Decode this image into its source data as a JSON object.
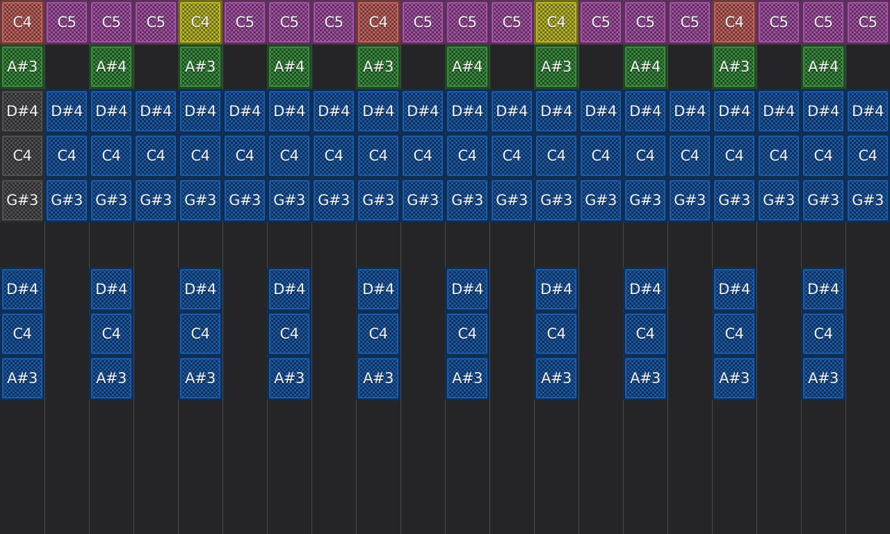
{
  "colors": {
    "background": "#252527",
    "grid_line": "#4a4a4d",
    "pink": [
      "#5c2f5c",
      "#a352a3"
    ],
    "red": [
      "#6b3a3a",
      "#c0605a"
    ],
    "yellow": [
      "#6d6a1a",
      "#b5b52a"
    ],
    "green": [
      "#1e4a22",
      "#3a8a3e"
    ],
    "blue": [
      "#0f2e55",
      "#1b5aa6"
    ],
    "gray": [
      "#2c2c2e",
      "#505052"
    ]
  },
  "rows": [
    {
      "id": "row-1",
      "cells": [
        {
          "label": "C4",
          "color": "red"
        },
        {
          "label": "C5",
          "color": "pink"
        },
        {
          "label": "C5",
          "color": "pink"
        },
        {
          "label": "C5",
          "color": "pink"
        },
        {
          "label": "C4",
          "color": "yellow"
        },
        {
          "label": "C5",
          "color": "pink"
        },
        {
          "label": "C5",
          "color": "pink"
        },
        {
          "label": "C5",
          "color": "pink"
        },
        {
          "label": "C4",
          "color": "red"
        },
        {
          "label": "C5",
          "color": "pink"
        },
        {
          "label": "C5",
          "color": "pink"
        },
        {
          "label": "C5",
          "color": "pink"
        },
        {
          "label": "C4",
          "color": "yellow"
        },
        {
          "label": "C5",
          "color": "pink"
        },
        {
          "label": "C5",
          "color": "pink"
        },
        {
          "label": "C5",
          "color": "pink"
        },
        {
          "label": "C4",
          "color": "red"
        },
        {
          "label": "C5",
          "color": "pink"
        },
        {
          "label": "C5",
          "color": "pink"
        },
        {
          "label": "C5",
          "color": "pink"
        }
      ]
    },
    {
      "id": "row-2",
      "cells": [
        {
          "label": "A#3",
          "color": "green"
        },
        null,
        {
          "label": "A#4",
          "color": "green"
        },
        null,
        {
          "label": "A#3",
          "color": "green"
        },
        null,
        {
          "label": "A#4",
          "color": "green"
        },
        null,
        {
          "label": "A#3",
          "color": "green"
        },
        null,
        {
          "label": "A#4",
          "color": "green"
        },
        null,
        {
          "label": "A#3",
          "color": "green"
        },
        null,
        {
          "label": "A#4",
          "color": "green"
        },
        null,
        {
          "label": "A#3",
          "color": "green"
        },
        null,
        {
          "label": "A#4",
          "color": "green"
        },
        null
      ]
    },
    {
      "id": "row-3",
      "cells": [
        {
          "label": "D#4",
          "color": "gray"
        },
        {
          "label": "D#4",
          "color": "blue"
        },
        {
          "label": "D#4",
          "color": "blue"
        },
        {
          "label": "D#4",
          "color": "blue"
        },
        {
          "label": "D#4",
          "color": "blue"
        },
        {
          "label": "D#4",
          "color": "blue"
        },
        {
          "label": "D#4",
          "color": "blue"
        },
        {
          "label": "D#4",
          "color": "blue"
        },
        {
          "label": "D#4",
          "color": "blue"
        },
        {
          "label": "D#4",
          "color": "blue"
        },
        {
          "label": "D#4",
          "color": "blue"
        },
        {
          "label": "D#4",
          "color": "blue"
        },
        {
          "label": "D#4",
          "color": "blue"
        },
        {
          "label": "D#4",
          "color": "blue"
        },
        {
          "label": "D#4",
          "color": "blue"
        },
        {
          "label": "D#4",
          "color": "blue"
        },
        {
          "label": "D#4",
          "color": "blue"
        },
        {
          "label": "D#4",
          "color": "blue"
        },
        {
          "label": "D#4",
          "color": "blue"
        },
        {
          "label": "D#4",
          "color": "blue"
        }
      ]
    },
    {
      "id": "row-4",
      "cells": [
        {
          "label": "C4",
          "color": "gray"
        },
        {
          "label": "C4",
          "color": "blue"
        },
        {
          "label": "C4",
          "color": "blue"
        },
        {
          "label": "C4",
          "color": "blue"
        },
        {
          "label": "C4",
          "color": "blue"
        },
        {
          "label": "C4",
          "color": "blue"
        },
        {
          "label": "C4",
          "color": "blue"
        },
        {
          "label": "C4",
          "color": "blue"
        },
        {
          "label": "C4",
          "color": "blue"
        },
        {
          "label": "C4",
          "color": "blue"
        },
        {
          "label": "C4",
          "color": "blue"
        },
        {
          "label": "C4",
          "color": "blue"
        },
        {
          "label": "C4",
          "color": "blue"
        },
        {
          "label": "C4",
          "color": "blue"
        },
        {
          "label": "C4",
          "color": "blue"
        },
        {
          "label": "C4",
          "color": "blue"
        },
        {
          "label": "C4",
          "color": "blue"
        },
        {
          "label": "C4",
          "color": "blue"
        },
        {
          "label": "C4",
          "color": "blue"
        },
        {
          "label": "C4",
          "color": "blue"
        }
      ]
    },
    {
      "id": "row-5",
      "cells": [
        {
          "label": "G#3",
          "color": "gray"
        },
        {
          "label": "G#3",
          "color": "blue"
        },
        {
          "label": "G#3",
          "color": "blue"
        },
        {
          "label": "G#3",
          "color": "blue"
        },
        {
          "label": "G#3",
          "color": "blue"
        },
        {
          "label": "G#3",
          "color": "blue"
        },
        {
          "label": "G#3",
          "color": "blue"
        },
        {
          "label": "G#3",
          "color": "blue"
        },
        {
          "label": "G#3",
          "color": "blue"
        },
        {
          "label": "G#3",
          "color": "blue"
        },
        {
          "label": "G#3",
          "color": "blue"
        },
        {
          "label": "G#3",
          "color": "blue"
        },
        {
          "label": "G#3",
          "color": "blue"
        },
        {
          "label": "G#3",
          "color": "blue"
        },
        {
          "label": "G#3",
          "color": "blue"
        },
        {
          "label": "G#3",
          "color": "blue"
        },
        {
          "label": "G#3",
          "color": "blue"
        },
        {
          "label": "G#3",
          "color": "blue"
        },
        {
          "label": "G#3",
          "color": "blue"
        },
        {
          "label": "G#3",
          "color": "blue"
        }
      ]
    },
    {
      "id": "row-6",
      "cells": [
        null,
        null,
        null,
        null,
        null,
        null,
        null,
        null,
        null,
        null,
        null,
        null,
        null,
        null,
        null,
        null,
        null,
        null,
        null,
        null
      ]
    },
    {
      "id": "row-7",
      "cells": [
        {
          "label": "D#4",
          "color": "blue"
        },
        null,
        {
          "label": "D#4",
          "color": "blue"
        },
        null,
        {
          "label": "D#4",
          "color": "blue"
        },
        null,
        {
          "label": "D#4",
          "color": "blue"
        },
        null,
        {
          "label": "D#4",
          "color": "blue"
        },
        null,
        {
          "label": "D#4",
          "color": "blue"
        },
        null,
        {
          "label": "D#4",
          "color": "blue"
        },
        null,
        {
          "label": "D#4",
          "color": "blue"
        },
        null,
        {
          "label": "D#4",
          "color": "blue"
        },
        null,
        {
          "label": "D#4",
          "color": "blue"
        },
        null
      ]
    },
    {
      "id": "row-8",
      "cells": [
        {
          "label": "C4",
          "color": "blue"
        },
        null,
        {
          "label": "C4",
          "color": "blue"
        },
        null,
        {
          "label": "C4",
          "color": "blue"
        },
        null,
        {
          "label": "C4",
          "color": "blue"
        },
        null,
        {
          "label": "C4",
          "color": "blue"
        },
        null,
        {
          "label": "C4",
          "color": "blue"
        },
        null,
        {
          "label": "C4",
          "color": "blue"
        },
        null,
        {
          "label": "C4",
          "color": "blue"
        },
        null,
        {
          "label": "C4",
          "color": "blue"
        },
        null,
        {
          "label": "C4",
          "color": "blue"
        },
        null
      ]
    },
    {
      "id": "row-9",
      "cells": [
        {
          "label": "A#3",
          "color": "blue"
        },
        null,
        {
          "label": "A#3",
          "color": "blue"
        },
        null,
        {
          "label": "A#3",
          "color": "blue"
        },
        null,
        {
          "label": "A#3",
          "color": "blue"
        },
        null,
        {
          "label": "A#3",
          "color": "blue"
        },
        null,
        {
          "label": "A#3",
          "color": "blue"
        },
        null,
        {
          "label": "A#3",
          "color": "blue"
        },
        null,
        {
          "label": "A#3",
          "color": "blue"
        },
        null,
        {
          "label": "A#3",
          "color": "blue"
        },
        null,
        {
          "label": "A#3",
          "color": "blue"
        },
        null
      ]
    }
  ]
}
